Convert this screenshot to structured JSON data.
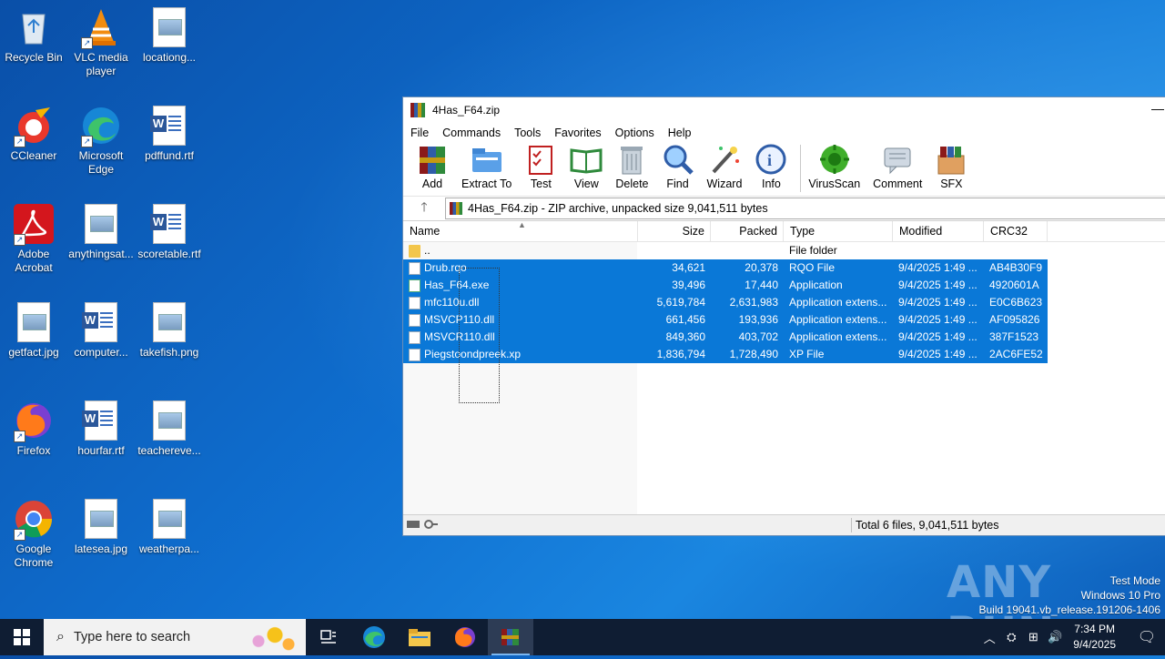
{
  "desktop": {
    "icons": [
      {
        "label": "Recycle Bin"
      },
      {
        "label": "VLC media player"
      },
      {
        "label": "locationg..."
      },
      {
        "label": "CCleaner"
      },
      {
        "label": "Microsoft Edge"
      },
      {
        "label": "pdffund.rtf"
      },
      {
        "label": "Adobe Acrobat"
      },
      {
        "label": "anythingsat..."
      },
      {
        "label": "scoretable.rtf"
      },
      {
        "label": "getfact.jpg"
      },
      {
        "label": "computer..."
      },
      {
        "label": "takefish.png"
      },
      {
        "label": "Firefox"
      },
      {
        "label": "hourfar.rtf"
      },
      {
        "label": "teachereve..."
      },
      {
        "label": "Google Chrome"
      },
      {
        "label": "latesea.jpg"
      },
      {
        "label": "weatherpa..."
      }
    ]
  },
  "window": {
    "title": "4Has_F64.zip",
    "menu": [
      "File",
      "Commands",
      "Tools",
      "Favorites",
      "Options",
      "Help"
    ],
    "toolbar": [
      "Add",
      "Extract To",
      "Test",
      "View",
      "Delete",
      "Find",
      "Wizard",
      "Info",
      "VirusScan",
      "Comment",
      "SFX"
    ],
    "address": "4Has_F64.zip - ZIP archive, unpacked size 9,041,511 bytes",
    "columns": {
      "name": "Name",
      "size": "Size",
      "packed": "Packed",
      "type": "Type",
      "modified": "Modified",
      "crc": "CRC32"
    },
    "files": [
      {
        "name": "..",
        "size": "",
        "packed": "",
        "type": "File folder",
        "modified": "",
        "crc": ""
      },
      {
        "name": "Drub.rqo",
        "size": "34,621",
        "packed": "20,378",
        "type": "RQO File",
        "modified": "9/4/2025 1:49 ...",
        "crc": "AB4B30F9"
      },
      {
        "name": "Has_F64.exe",
        "size": "39,496",
        "packed": "17,440",
        "type": "Application",
        "modified": "9/4/2025 1:49 ...",
        "crc": "4920601A"
      },
      {
        "name": "mfc110u.dll",
        "size": "5,619,784",
        "packed": "2,631,983",
        "type": "Application extens...",
        "modified": "9/4/2025 1:49 ...",
        "crc": "E0C6B623"
      },
      {
        "name": "MSVCP110.dll",
        "size": "661,456",
        "packed": "193,936",
        "type": "Application extens...",
        "modified": "9/4/2025 1:49 ...",
        "crc": "AF095826"
      },
      {
        "name": "MSVCR110.dll",
        "size": "849,360",
        "packed": "403,702",
        "type": "Application extens...",
        "modified": "9/4/2025 1:49 ...",
        "crc": "387F1523"
      },
      {
        "name": "Piegstoondpreek.xp",
        "size": "1,836,794",
        "packed": "1,728,490",
        "type": "XP File",
        "modified": "9/4/2025 1:49 ...",
        "crc": "2AC6FE52"
      }
    ],
    "status": "Total 6 files, 9,041,511 bytes"
  },
  "watermark": {
    "brand": "ANY RUN",
    "line1": "Test Mode",
    "line2": "Windows 10 Pro",
    "line3": "Build 19041.vb_release.191206-1406"
  },
  "taskbar": {
    "search_placeholder": "Type here to search",
    "time": "7:34 PM",
    "date": "9/4/2025"
  },
  "colors": {
    "selection": "#0a78d7",
    "taskbar": "#0f1d33"
  }
}
